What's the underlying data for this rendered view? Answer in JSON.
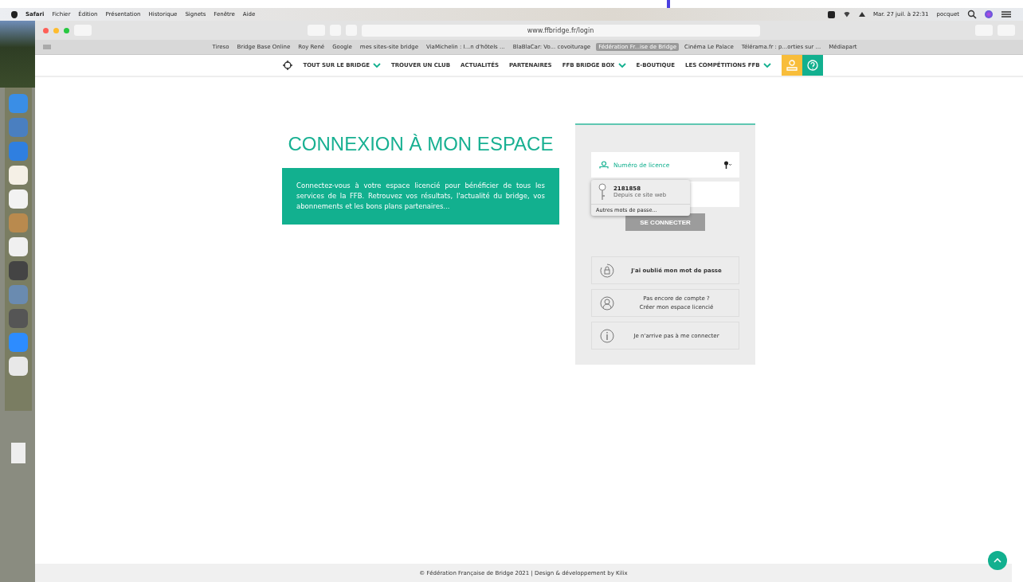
{
  "menubar": {
    "app": "Safari",
    "items": [
      "Fichier",
      "Édition",
      "Présentation",
      "Historique",
      "Signets",
      "Fenêtre",
      "Aide"
    ],
    "clock": "Mar. 27 juil. à 22:31",
    "user": "pocquet"
  },
  "browser": {
    "url": "www.ffbridge.fr/login",
    "bookmarks": [
      {
        "label": "Tireso",
        "selected": false
      },
      {
        "label": "Bridge Base Online",
        "selected": false
      },
      {
        "label": "Roy René",
        "selected": false
      },
      {
        "label": "Google",
        "selected": false
      },
      {
        "label": "mes sites-site bridge",
        "selected": false
      },
      {
        "label": "ViaMichelin : I...n d'hôtels ...",
        "selected": false
      },
      {
        "label": "BlaBlaCar: Vo... covoiturage",
        "selected": false
      },
      {
        "label": "Fédération Fr...ise de Bridge",
        "selected": true
      },
      {
        "label": "Cinéma Le Palace",
        "selected": false
      },
      {
        "label": "Télérama.fr : p...orties sur ...",
        "selected": false
      },
      {
        "label": "Médiapart",
        "selected": false
      }
    ]
  },
  "nav": {
    "items": [
      {
        "label": "TOUT SUR LE BRIDGE",
        "dropdown": true
      },
      {
        "label": "TROUVER UN CLUB",
        "dropdown": false
      },
      {
        "label": "ACTUALITÉS",
        "dropdown": false
      },
      {
        "label": "PARTENAIRES",
        "dropdown": false
      },
      {
        "label": "FFB BRIDGE BOX",
        "dropdown": true
      },
      {
        "label": "E-BOUTIQUE",
        "dropdown": false
      },
      {
        "label": "LES COMPÉTITIONS FFB",
        "dropdown": true
      }
    ]
  },
  "login": {
    "title": "CONNEXION À MON ESPACE",
    "intro": "Connectez-vous à votre espace licencié pour bénéficier de tous les services de la FFB. Retrouvez vos résultats, l'actualité du bridge, vos abonnements et les bons plans partenaires...",
    "username_placeholder": "Numéro de licence",
    "autofill": {
      "username": "2181858",
      "source": "Depuis ce site web",
      "other": "Autres mots de passe..."
    },
    "submit": "SE CONNECTER",
    "links": [
      {
        "kind": "forgot",
        "lines": [
          "J'ai oublié mon mot de passe"
        ]
      },
      {
        "kind": "signup",
        "lines": [
          "Pas encore de compte ?",
          "Créer mon espace licencié"
        ]
      },
      {
        "kind": "help",
        "lines": [
          "Je n'arrive pas à me connecter"
        ]
      }
    ]
  },
  "footer": "© Fédération Française de Bridge 2021 | Design & développement by Kilix"
}
